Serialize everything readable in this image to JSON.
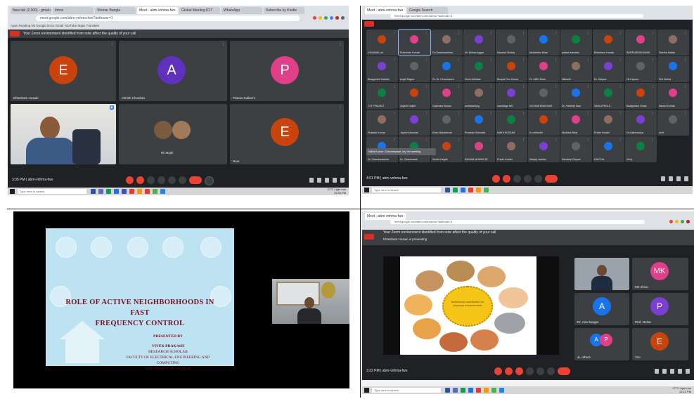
{
  "top_left": {
    "tabs": [
      "New tab (2,000) - gmail.com",
      "Inbox",
      "Shonar Bangla",
      "Meet - abm-vnhma-fwo",
      "Global Meeting ICIT",
      "WhatsApp",
      "Subscribe by Kindle"
    ],
    "address": "meet.google.com/abm-vnhma-fwo?authuser=1",
    "bookmarks": "Apps   Reading list   Google Docs   Gmail   YouTube   Maps   Translate",
    "info_banner": "Your Zoom environment identified from note affect the quality of your call",
    "participants": [
      {
        "initial": "E",
        "name": "Ehtesham Husain",
        "color": "#c9430d"
      },
      {
        "initial": "A",
        "name": "Ashish Chouhan",
        "color": "#5f32bd"
      },
      {
        "initial": "P",
        "name": "Pranav Kulkarni",
        "color": "#e03f8a"
      },
      {
        "initial": "",
        "name": "",
        "color": ""
      },
      {
        "initial": "",
        "name": "Rii Majhi",
        "color": ""
      },
      {
        "initial": "E",
        "name": "Noor",
        "color": "#c9430d"
      }
    ],
    "time": "3:35 PM  |  abm-vnhma-fwo",
    "taskbar_search": "Type here to search",
    "tray": "27°C Light rain",
    "clock": "15:35 PM"
  },
  "top_right": {
    "tabs": [
      "Meet - abm-vnhma-fwo",
      "Google Search"
    ],
    "address": "meet.google.com/abm-vnhma-fwo?authuser=1",
    "grid_names": [
      "CHAMAN Lal",
      "Ehtesham Husain",
      "Dr.Chandrasekhar",
      "Dr. Mohan Aggar",
      "Kaushal Shukla",
      "Muralidhar Kilari",
      "pallavi mandale",
      "Ehtesham Husain",
      "SURENDRAKUMAR",
      "Geetha Kottan",
      "Bhagyashri Kamble",
      "Anjali Rajput",
      "Dr. Dr. Chandrasek",
      "Vivek Athlekar",
      "Bhupat Dev Kumar",
      "Dr. MRH Khan",
      "Nilkanth",
      "Dr. Kalyani",
      "Hit Kapoor",
      "Priti Mehta",
      "C.R. PRAJATI",
      "yogesh majhe",
      "Gajendra Mohan",
      "amritaramjog",
      "mandrage MD",
      "GOVIND BHAVSAR",
      "Dr. Paramjit Kaur",
      "SAHILIPRIA K.",
      "Bhagyashri Ghate",
      "Dinesh Kumar",
      "Prakash Kumar",
      "Jayant Manohar",
      "Kiran Mahadevan",
      "Pradeep Ghevaria",
      "NIDHI BUDIUM",
      "K.Lekhbuhe",
      "Abhilash Bhat",
      "Pravin Kedari",
      "Dr.Lakhmaniya",
      "Amit",
      "Dr. Chandrasekhar",
      "Dr. Chandrasek",
      "Sunita Hegde",
      "RAHAM MHSAN SE",
      "Pravin Kedari",
      "Sanjay Jadhav",
      "Sandeep Dhyani",
      "KAVTHA",
      "Vinoj"
    ],
    "tooltip": "Nikhil Kumar Chandrasekar Joy Yet meeting",
    "time": "4:01 PM  |  abm-vnhma-fwo"
  },
  "bottom_left": {
    "slide_title_line1": "ROLE OF ACTIVE NEIGHBORHOODS IN FAST",
    "slide_title_line2": "FREQUENCY CONTROL",
    "presented_by": "PRESENTED BY",
    "presenter_name": "VIVEK PRAKASH",
    "presenter_role": "RESEARCH SCHOLAR",
    "presenter_dept": "FACULTY OF ELECTRICAL ENGINEERING AND COMPUTING",
    "presenter_univ": "UNIVERSITY OF ZAGREB"
  },
  "bottom_right": {
    "address": "meet.google.com/abm-vnhma-fwo?authuser=1",
    "info_banner": "Your Zoom environment identified from note affect the quality of your call",
    "presenting_banner": "Ehtesham Husain is presenting",
    "center_label": "Authorized contribution for proposal enhancement",
    "participants": [
      {
        "initial": "",
        "name": "",
        "color": ""
      },
      {
        "initial": "MK",
        "name": "MK shivu",
        "color": "#e03f8a"
      },
      {
        "initial": "A",
        "name": "Dr. Ana Sanger",
        "color": "#1a73e8"
      },
      {
        "initial": "P",
        "name": "Prof. Gelsa",
        "color": "#7b3fd1"
      },
      {
        "initial": "A P",
        "name": "4+ others",
        "color": "#7b3fd1"
      },
      {
        "initial": "E",
        "name": "You",
        "color": "#c9430d"
      }
    ],
    "time": "3:22 PM  |  abm-vnhma-fwo",
    "taskbar_search": "Type here to search",
    "tray": "27°C Light rain",
    "clock": "15:22 PM"
  },
  "colors": {
    "meet_bg": "#202124",
    "tile_bg": "#3c4043",
    "end_call": "#ea4335",
    "slide_bg": "#bde3f2",
    "slide_title": "#7a1020"
  }
}
